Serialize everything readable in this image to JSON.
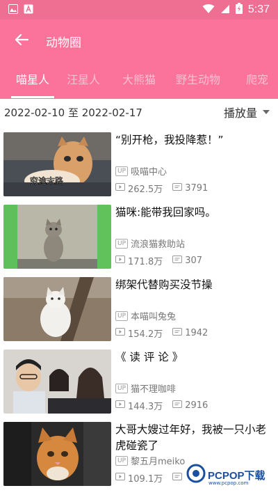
{
  "status_bar": {
    "time": "5:37",
    "icons": [
      "image-icon",
      "font-icon",
      "wifi-icon",
      "cellular-icon",
      "battery-charging-icon"
    ]
  },
  "app_bar": {
    "title": "动物圈",
    "back_icon": "back-arrow-icon"
  },
  "tabs": [
    {
      "label": "喵星人",
      "active": true
    },
    {
      "label": "汪星人",
      "active": false
    },
    {
      "label": "大熊猫",
      "active": false
    },
    {
      "label": "野生动物",
      "active": false
    },
    {
      "label": "爬宠",
      "active": false
    }
  ],
  "filter": {
    "date_range": "2022-02-10 至 2022-02-17",
    "sort_label": "播放量"
  },
  "videos": [
    {
      "title": "“别开枪，我投降惹！”",
      "up_badge": "UP",
      "uploader": "吸喵中心",
      "views": "262.5万",
      "comments": "3791",
      "overlay": "穷途末路"
    },
    {
      "title": "猫咪:能带我回家吗。",
      "up_badge": "UP",
      "uploader": "流浪猫救助站",
      "views": "171.8万",
      "comments": "307"
    },
    {
      "title": "绑架代替购买没节操",
      "up_badge": "UP",
      "uploader": "本喵叫兔兔",
      "views": "154.2万",
      "comments": "1942"
    },
    {
      "title": "《 读 评 论 》",
      "up_badge": "UP",
      "uploader": "猫不理咖啡",
      "views": "144.3万",
      "comments": "2916"
    },
    {
      "title": "大哥大嫂过年好，我被一只小老虎碰瓷了",
      "up_badge": "UP",
      "uploader": "黎五月meiko",
      "views": "109.1万",
      "comments": ""
    }
  ],
  "watermark": {
    "text": "PCPOP下载",
    "sub": "www.pcpop.com"
  },
  "colors": {
    "primary": "#fb729b",
    "status_bar": "#ee6f92",
    "text_main": "#111111",
    "text_sub": "#777777"
  }
}
